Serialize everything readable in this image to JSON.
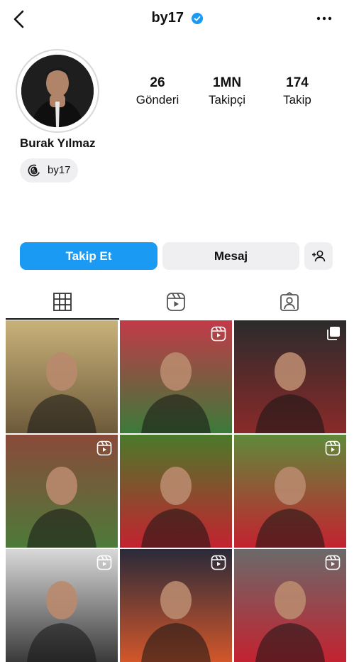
{
  "header": {
    "username": "by17"
  },
  "profile": {
    "display_name": "Burak Yılmaz",
    "threads_label": "by17"
  },
  "stats": [
    {
      "value": "26",
      "label": "Gönderi"
    },
    {
      "value": "1MN",
      "label": "Takipçi"
    },
    {
      "value": "174",
      "label": "Takip"
    }
  ],
  "actions": {
    "follow_label": "Takip Et",
    "message_label": "Mesaj"
  },
  "tabs": [
    "posts-grid-icon",
    "reels-icon",
    "tagged-icon"
  ],
  "posts": [
    {
      "type": "photo",
      "colors": [
        "#c9b27a",
        "#6d5a3a"
      ]
    },
    {
      "type": "reel",
      "colors": [
        "#c23a48",
        "#3c7a3a"
      ]
    },
    {
      "type": "carousel",
      "colors": [
        "#2b2b2b",
        "#8a2a2a"
      ]
    },
    {
      "type": "reel",
      "colors": [
        "#8a4a3a",
        "#4d7a3a"
      ]
    },
    {
      "type": "photo",
      "colors": [
        "#4a7a2a",
        "#c42230"
      ]
    },
    {
      "type": "reel",
      "colors": [
        "#5f8a3a",
        "#c42230"
      ]
    },
    {
      "type": "reel",
      "colors": [
        "#d9d9d9",
        "#3a3a3a"
      ]
    },
    {
      "type": "reel",
      "colors": [
        "#2a2a3a",
        "#d2572a"
      ]
    },
    {
      "type": "reel",
      "colors": [
        "#6a6a6a",
        "#c42230"
      ]
    }
  ]
}
